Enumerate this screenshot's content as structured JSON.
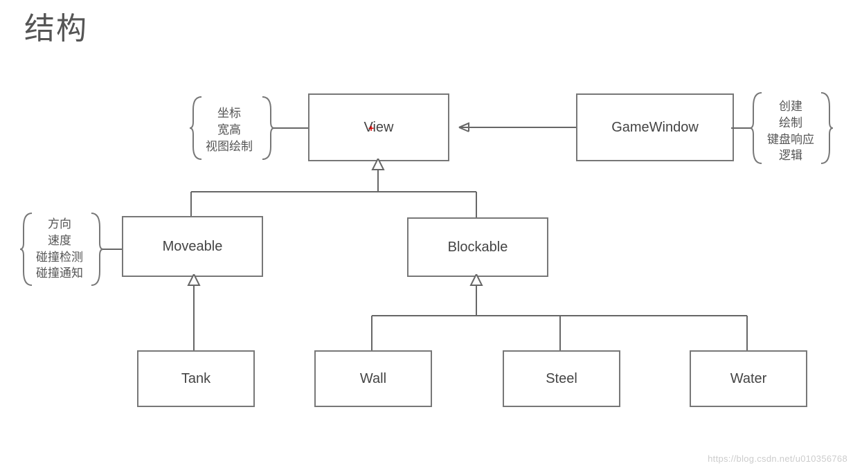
{
  "title": "结构",
  "nodes": {
    "view": "View",
    "gamewindow": "GameWindow",
    "moveable": "Moveable",
    "blockable": "Blockable",
    "tank": "Tank",
    "wall": "Wall",
    "steel": "Steel",
    "water": "Water"
  },
  "notes": {
    "view": "坐标\n宽高\n视图绘制",
    "gamewindow": "创建\n绘制\n键盘响应\n逻辑",
    "moveable": "方向\n速度\n碰撞检测\n碰撞通知"
  },
  "watermark": "https://blog.csdn.net/u010356768"
}
